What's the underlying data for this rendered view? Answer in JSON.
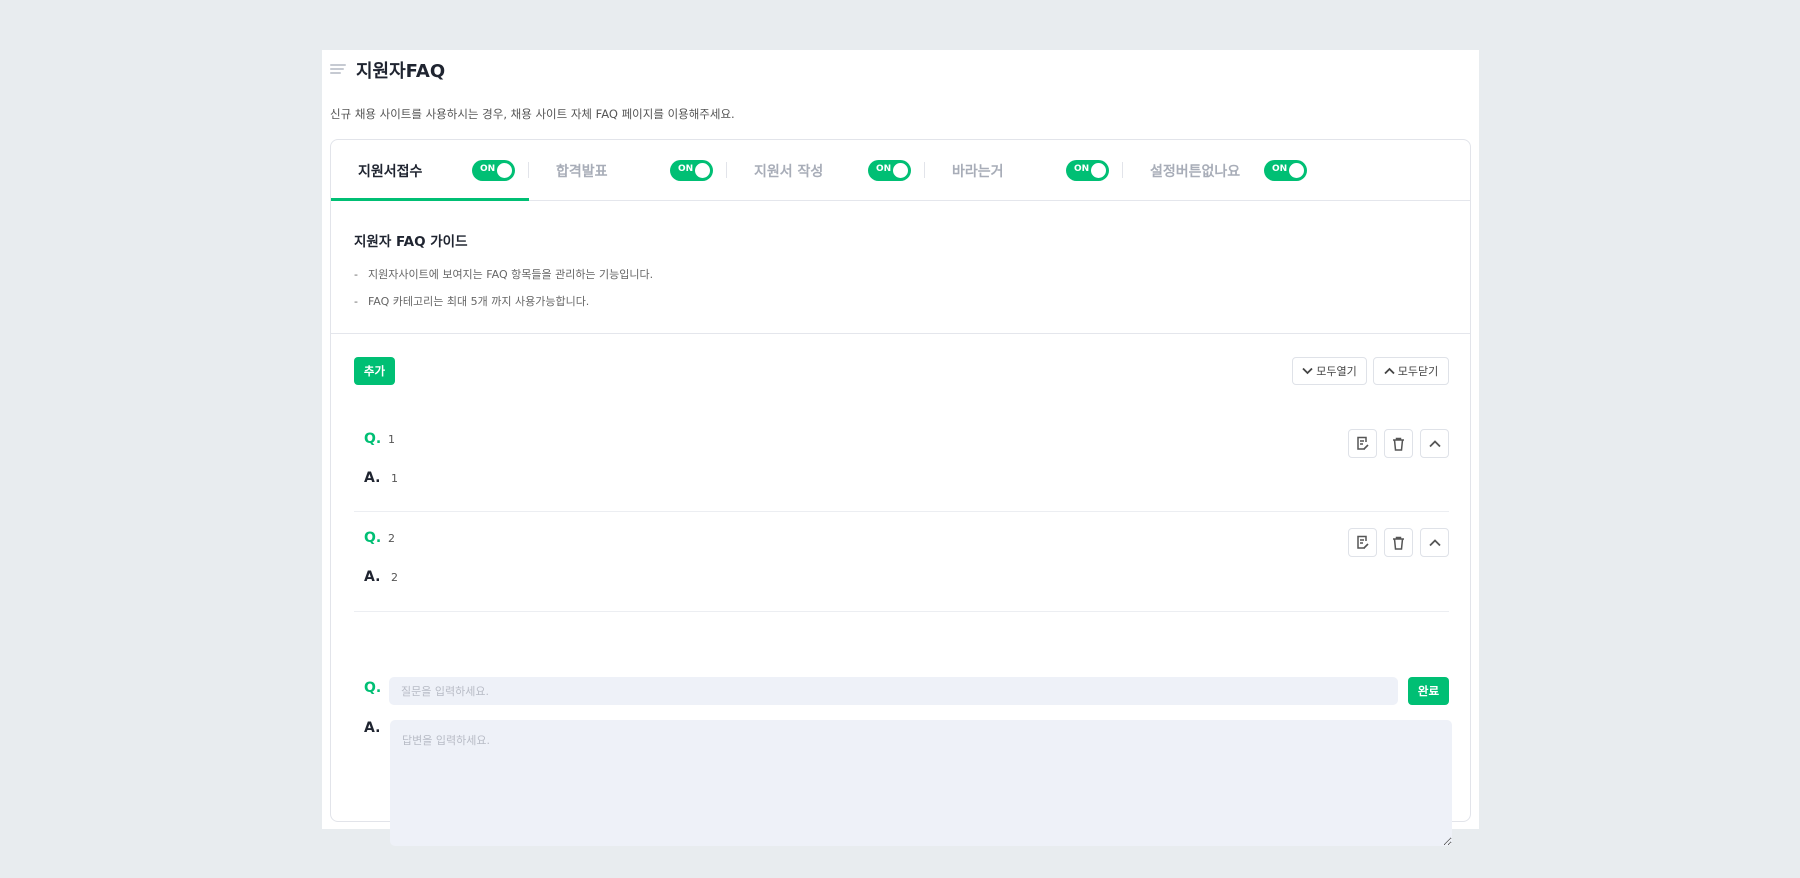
{
  "header": {
    "title": "지원자FAQ",
    "subtitle": "신규 채용 사이트를 사용하시는 경우, 채용 사이트 자체 FAQ 페이지를 이용해주세요."
  },
  "tabs": [
    {
      "label": "지원서접수",
      "toggle": "ON",
      "active": true
    },
    {
      "label": "합격발표",
      "toggle": "ON"
    },
    {
      "label": "지원서 작성",
      "toggle": "ON"
    },
    {
      "label": "바라는거",
      "toggle": "ON"
    },
    {
      "label": "설정버튼없나요",
      "toggle": "ON"
    }
  ],
  "guide": {
    "title": "지원자 FAQ 가이드",
    "dash": "-",
    "items": [
      "지원자사이트에 보여지는 FAQ 항목들을 관리하는 기능입니다.",
      "FAQ 카테고리는 최대 5개 까지 사용가능합니다."
    ]
  },
  "toolbar": {
    "add": "추가",
    "expand_all": "모두열기",
    "collapse_all": "모두닫기"
  },
  "faq": {
    "q_mark": "Q.",
    "a_mark": "A.",
    "items": [
      {
        "q": "1",
        "a": "1"
      },
      {
        "q": "2",
        "a": "2"
      }
    ]
  },
  "new_entry": {
    "q_placeholder": "질문을 입력하세요.",
    "a_placeholder": "답변을 입력하세요.",
    "done": "완료"
  },
  "colors": {
    "accent": "#00bf74"
  }
}
